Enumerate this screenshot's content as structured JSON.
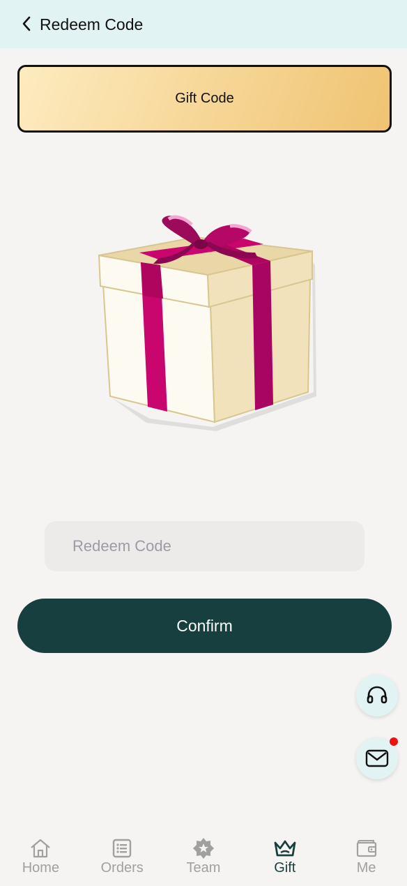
{
  "header": {
    "title": "Redeem Code",
    "back_icon": "chevron-left-icon"
  },
  "gift_card": {
    "label": "Gift Code"
  },
  "redeem": {
    "placeholder": "Redeem Code",
    "value": "",
    "confirm_label": "Confirm"
  },
  "floating": {
    "support_icon": "headset-icon",
    "message_icon": "envelope-icon",
    "has_unread": true
  },
  "nav": {
    "items": [
      {
        "label": "Home",
        "icon": "house-icon",
        "active": false
      },
      {
        "label": "Orders",
        "icon": "list-icon",
        "active": false
      },
      {
        "label": "Team",
        "icon": "star-badge-icon",
        "active": false
      },
      {
        "label": "Gift",
        "icon": "crown-icon",
        "active": true
      },
      {
        "label": "Me",
        "icon": "wallet-icon",
        "active": false
      }
    ]
  },
  "colors": {
    "header_bg": "#e1f3f2",
    "primary": "#183f3f",
    "background": "#f6f4f2",
    "ribbon": "#c8066e",
    "card_gradient_start": "#fdebc0",
    "card_gradient_end": "#efc372",
    "notification_dot": "#ee1111",
    "nav_inactive": "#a0a0a0"
  }
}
